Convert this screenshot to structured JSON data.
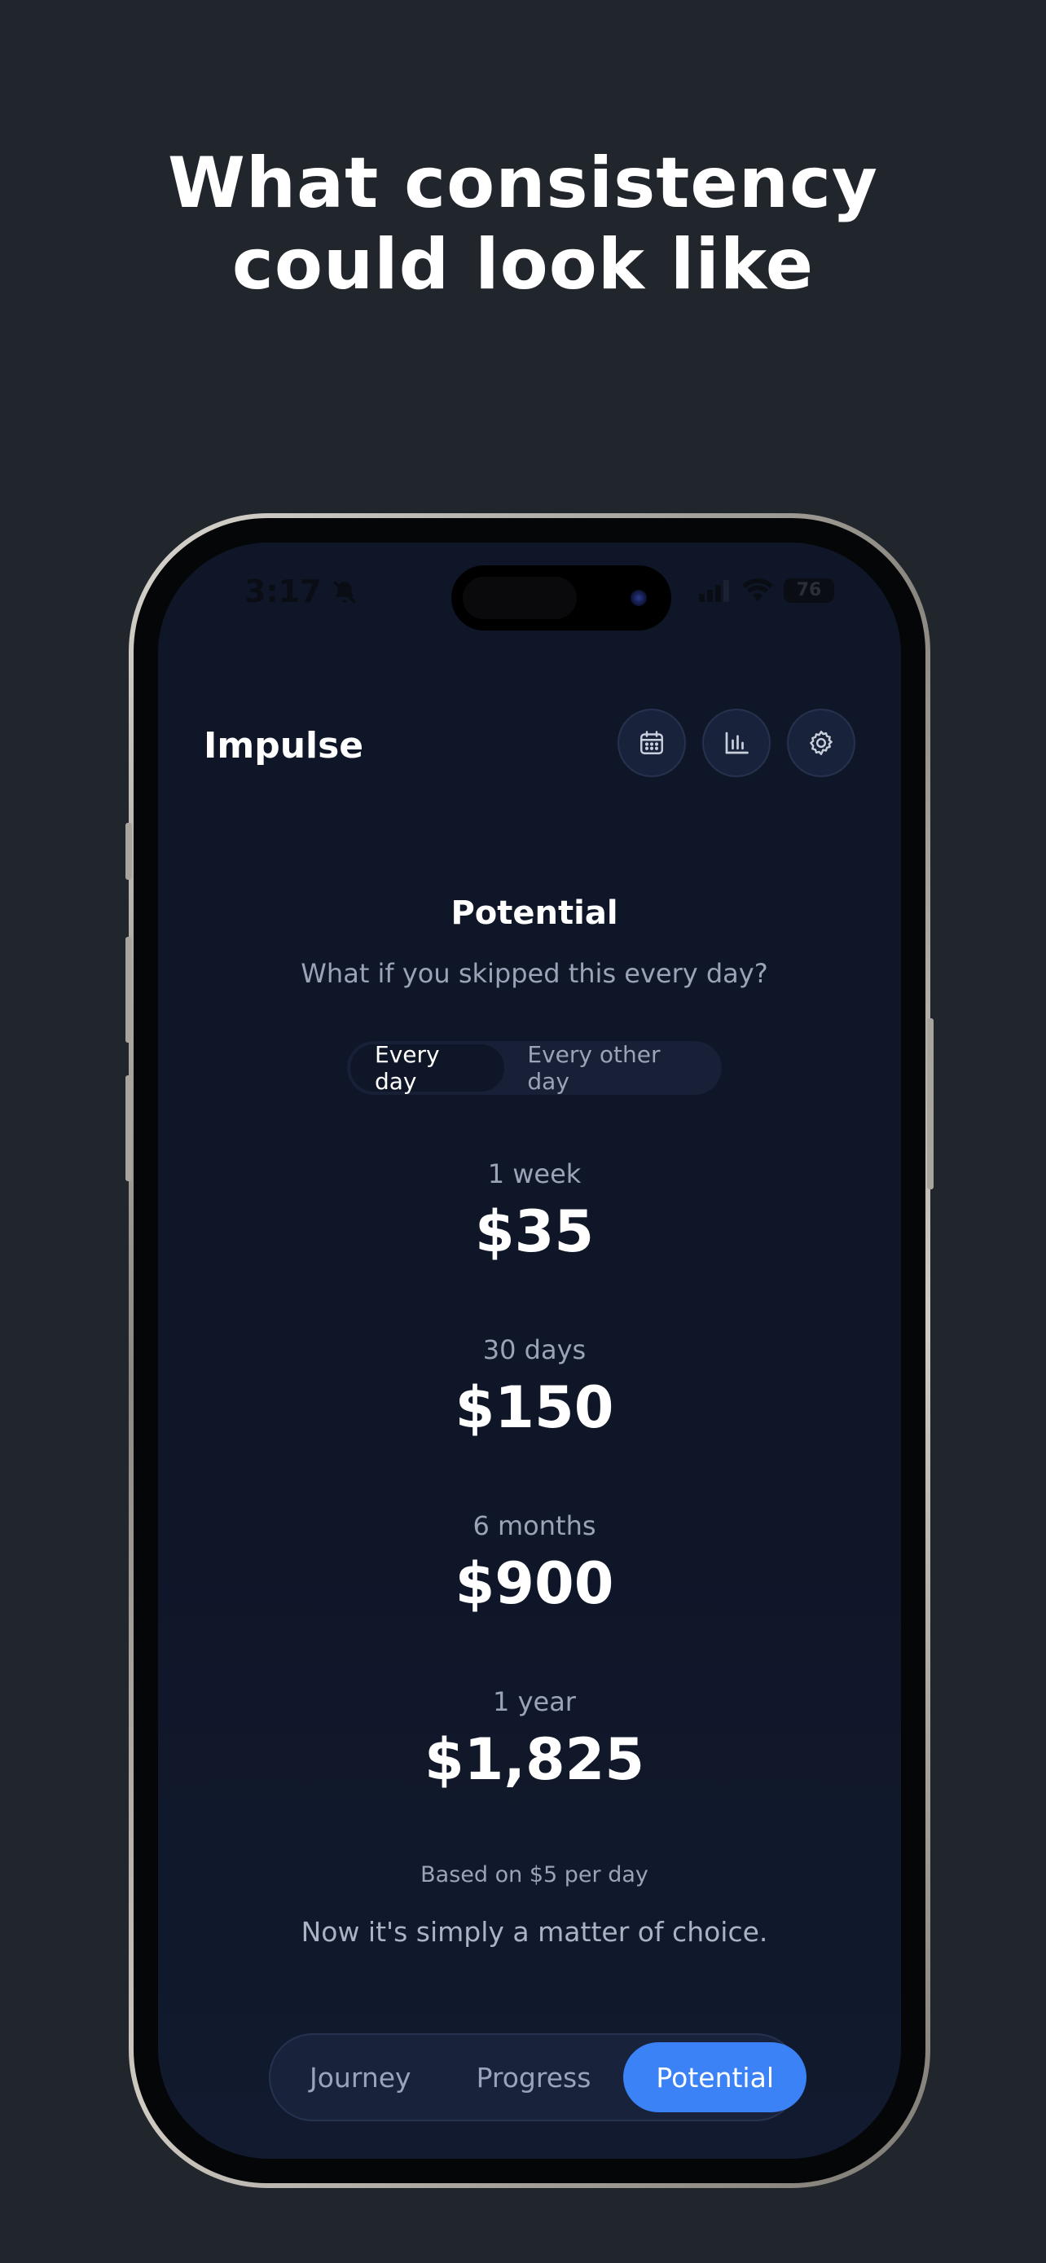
{
  "headline": {
    "line1": "What consistency",
    "line2": "could look like"
  },
  "status_bar": {
    "time": "3:17",
    "battery": "76"
  },
  "header": {
    "app_title": "Impulse",
    "icons": [
      "calendar-icon",
      "bar-chart-icon",
      "gear-icon"
    ]
  },
  "potential": {
    "title": "Potential",
    "subtitle": "What if you skipped this every day?",
    "frequency": {
      "options": [
        "Every day",
        "Every other day"
      ],
      "selected": "Every day"
    },
    "projections": [
      {
        "label": "1 week",
        "value": "$35"
      },
      {
        "label": "30 days",
        "value": "$150"
      },
      {
        "label": "6 months",
        "value": "$900"
      },
      {
        "label": "1 year",
        "value": "$1,825"
      }
    ],
    "basis": "Based on $5 per day",
    "closing": "Now it's simply a matter of choice."
  },
  "tabs": {
    "items": [
      "Journey",
      "Progress",
      "Potential"
    ],
    "selected": "Potential"
  },
  "colors": {
    "page_bg": "#21252c",
    "screen_bg": "#0f1628",
    "accent": "#3b82f6",
    "muted_text": "#9aa3b8"
  }
}
